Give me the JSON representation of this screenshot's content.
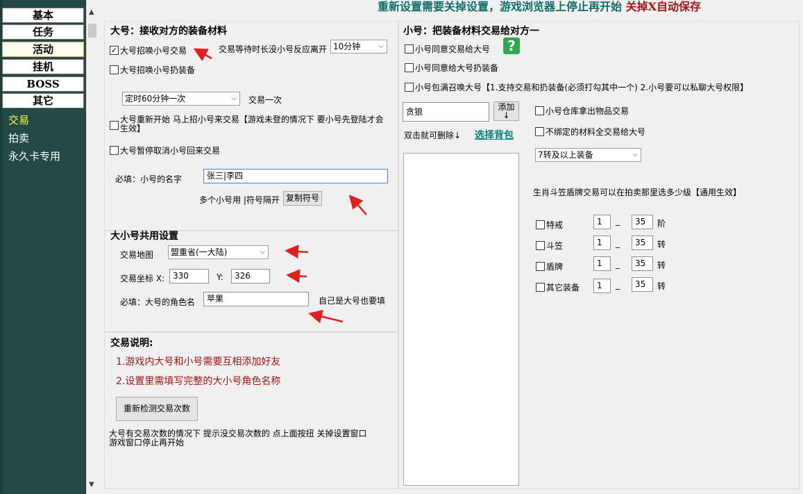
{
  "nav": {
    "buttons": [
      "基本",
      "任务",
      "活动",
      "挂机",
      "BOSS",
      "其它"
    ],
    "active_button": "活动",
    "sub_items": [
      "交易",
      "拍卖",
      "永久卡专用"
    ],
    "active_sub": "交易"
  },
  "header": {
    "text": "重新设置需要关掉设置，游戏浏览器上停止再开始",
    "highlight": "关掉X自动保存"
  },
  "main": {
    "title": "大号：接收对方的装备材料",
    "summon_trade": {
      "label": "大号招唤小号交易",
      "checked": true
    },
    "wait_label": "交易等待时长没小号反应离开",
    "wait_value": "10分钟",
    "summon_drop": {
      "label": "大号招唤小号扔装备",
      "checked": false
    },
    "timer_value": "定时60分钟一次",
    "timer_suffix": "交易一次",
    "restart": {
      "label": "大号重新开始 马上招小号来交易【游戏未登的情况下 要小号先登陆才会生效】",
      "checked": false
    },
    "pause": {
      "label": "大号暂停取消小号回来交易",
      "checked": false
    },
    "alt_name_label": "必填：小号的名字",
    "alt_name_value": "张三|李四",
    "separator_hint": "多个小号用 |符号隔开",
    "copy_symbol_btn": "复制符号"
  },
  "shared": {
    "title": "大小号共用设置",
    "map_label": "交易地图",
    "map_value": "盟重省(一大陆)",
    "coord_label": "交易坐标 X:",
    "x_value": "330",
    "y_label": "Y:",
    "y_value": "326",
    "main_name_label": "必填：大号的角色名",
    "main_name_value": "苹果",
    "main_name_hint": "自己是大号也要填"
  },
  "notes": {
    "title": "交易说明:",
    "items": [
      "1.游戏内大号和小号需要互相添加好友",
      "2.设置里需填写完整的大小号角色名称"
    ],
    "recheck_btn": "重新检测交易次数",
    "footer": "大号有交易次数的情况下 提示没交易次数的 点上面按扭 关掉设置窗口 游戏窗口停止再开始"
  },
  "alt": {
    "title": "小号：把装备材料交易给对方一",
    "agree_trade": {
      "label": "小号同意交易给大号",
      "checked": false
    },
    "help_icon": "?",
    "agree_drop": {
      "label": "小号同意给大号扔装备",
      "checked": false
    },
    "bag_full": {
      "label": "小号包满召唤大号【1.支持交易和扔装备(必须打勾其中一个) 2.小号要可以私聊大号权限】",
      "checked": false
    },
    "item_input_value": "贪狼",
    "add_btn": "添加",
    "add_btn_arrow": "↓",
    "dblclick_hint": "双击就可删除↓",
    "select_bag_link": "选择背包",
    "warehouse": {
      "label": "小号仓库拿出物品交易",
      "checked": false
    },
    "unbound_all": {
      "label": "不绑定的材料全交易给大号",
      "checked": false
    },
    "equip_filter": "7转及以上装备",
    "zodiac_hint": "生肖斗笠盾牌交易可以在拍卖那里选多少级【通用生效】",
    "ranges": [
      {
        "label": "特戒",
        "min": "1",
        "max": "35",
        "unit": "阶"
      },
      {
        "label": "斗笠",
        "min": "1",
        "max": "35",
        "unit": "转"
      },
      {
        "label": "盾牌",
        "min": "1",
        "max": "35",
        "unit": "转"
      },
      {
        "label": "其它装备",
        "min": "1",
        "max": "35",
        "unit": "转"
      }
    ],
    "range_dash": "_"
  }
}
